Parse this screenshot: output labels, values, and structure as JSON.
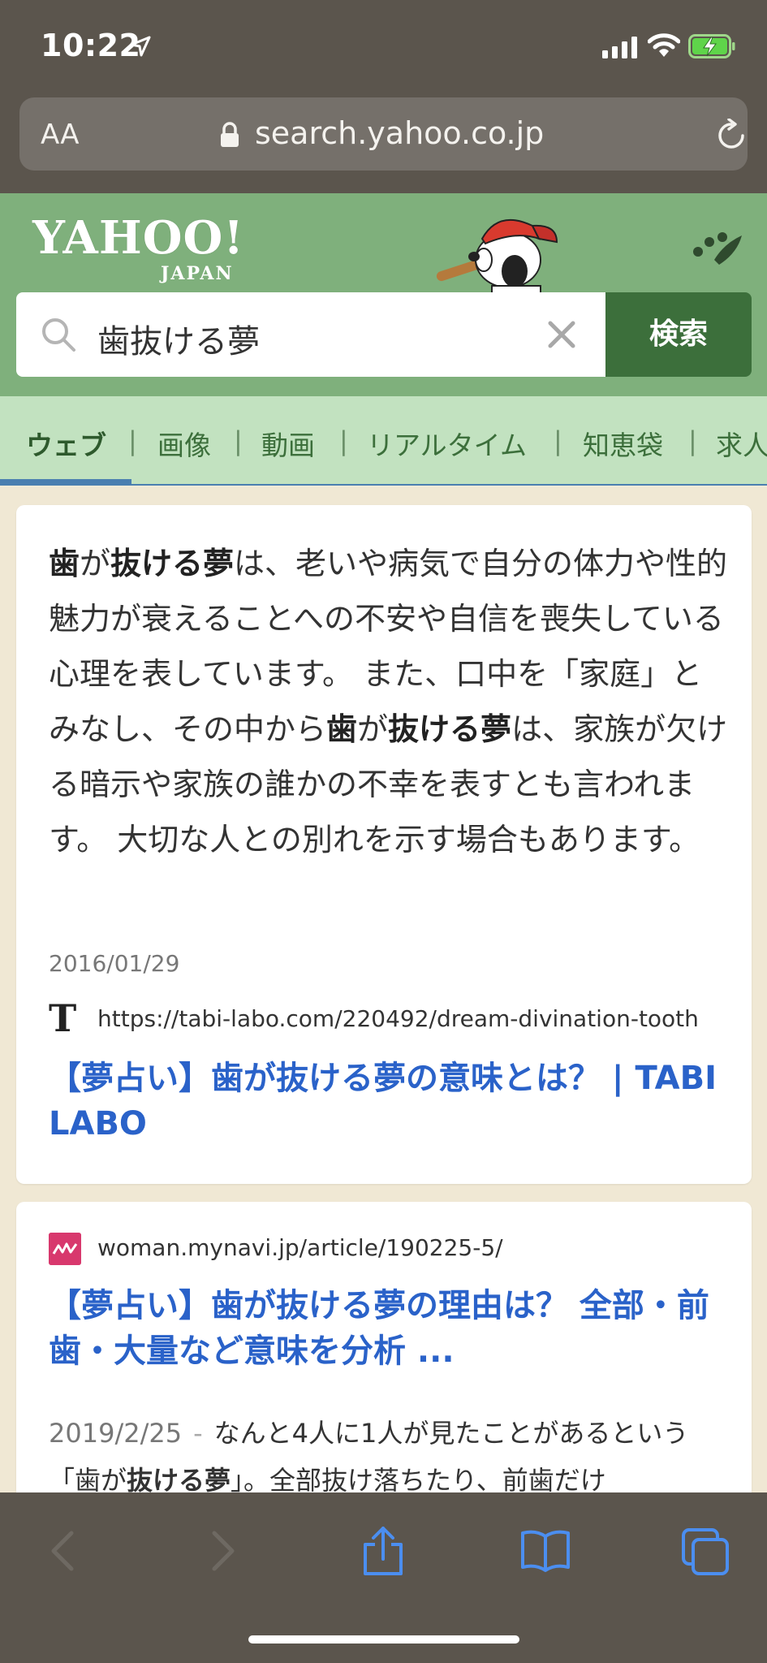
{
  "status_bar": {
    "time": "10:22"
  },
  "address_bar": {
    "aa_label": "AA",
    "url": "search.yahoo.co.jp"
  },
  "header": {
    "logo_main": "YAHOO!",
    "logo_sub": "JAPAN"
  },
  "search": {
    "query": "歯抜ける夢",
    "button_label": "検索"
  },
  "tabs": [
    {
      "label": "ウェブ",
      "active": true
    },
    {
      "label": "画像"
    },
    {
      "label": "動画"
    },
    {
      "label": "リアルタイム"
    },
    {
      "label": "知恵袋"
    },
    {
      "label": "求人"
    }
  ],
  "results": [
    {
      "snippet_parts": [
        {
          "t": "歯",
          "b": true
        },
        {
          "t": "が"
        },
        {
          "t": "抜ける夢",
          "b": true
        },
        {
          "t": "は、老いや病気で自分の体力や性的魅力が衰えることへの不安や自信を喪失している心理を表しています。 また、口中を「家庭」とみなし、その中から"
        },
        {
          "t": "歯",
          "b": true
        },
        {
          "t": "が"
        },
        {
          "t": "抜ける夢",
          "b": true
        },
        {
          "t": "は、家族が欠ける暗示や家族の誰かの不幸を表すとも言われます。 大切な人との別れを示す場合もあります。"
        }
      ],
      "date": "2016/01/29",
      "url": "https://tabi-labo.com/220492/dream-divination-tooth",
      "title": "【夢占い】歯が抜ける夢の意味とは？ | TABI LABO"
    },
    {
      "url": "woman.mynavi.jp/article/190225-5/",
      "title": "【夢占い】歯が抜ける夢の理由は？ 全部・前歯・大量など意味を分析 ...",
      "date": "2019/2/25",
      "dash": "-",
      "snippet_parts": [
        {
          "t": "なんと4人に1人が見たことがあるという「歯が"
        },
        {
          "t": "抜ける夢",
          "b": true
        },
        {
          "t": "」。全部抜け落ちたり、前歯だけ"
        }
      ]
    }
  ],
  "colors": {
    "header_green": "#7fb07c",
    "tab_green": "#c2e2c0",
    "search_button": "#3c6f3b",
    "link_blue": "#2a62c9",
    "chrome": "#5b554d"
  }
}
